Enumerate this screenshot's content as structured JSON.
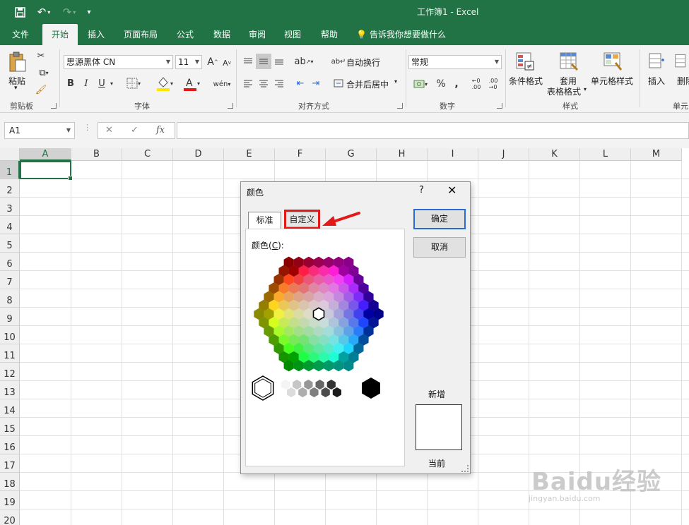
{
  "window": {
    "title": "工作簿1  -  Excel",
    "qat": [
      "save-icon",
      "undo-icon",
      "redo-icon",
      "customize-qat-icon"
    ]
  },
  "tabs": [
    {
      "label": "文件"
    },
    {
      "label": "开始",
      "active": true
    },
    {
      "label": "插入"
    },
    {
      "label": "页面布局"
    },
    {
      "label": "公式"
    },
    {
      "label": "数据"
    },
    {
      "label": "审阅"
    },
    {
      "label": "视图"
    },
    {
      "label": "帮助"
    }
  ],
  "tell_me": "告诉我你想要做什么",
  "ribbon": {
    "clipboard": {
      "paste": "粘贴",
      "label": "剪贴板"
    },
    "font": {
      "name": "思源黑体 CN",
      "size": "11",
      "label": "字体",
      "bold": "B",
      "italic": "I",
      "underline": "U",
      "font_color": "#e31919",
      "fill_color": "#ffe600"
    },
    "alignment": {
      "wrap": "自动换行",
      "merge": "合并后居中",
      "label": "对齐方式"
    },
    "number": {
      "format": "常规",
      "label": "数字",
      "percent": "%",
      "comma": ","
    },
    "styles": {
      "conditional": "条件格式",
      "table_line1": "套用",
      "table_line2": "表格格式",
      "cell_styles": "单元格样式",
      "label": "样式"
    },
    "cells": {
      "insert": "插入",
      "delete": "删除",
      "label": "单元"
    }
  },
  "formula_bar": {
    "name_box": "A1",
    "fx": "fx",
    "formula": ""
  },
  "grid": {
    "columns": [
      "A",
      "B",
      "C",
      "D",
      "E",
      "F",
      "G",
      "H",
      "I",
      "J",
      "K",
      "L",
      "M"
    ],
    "rows": [
      "1",
      "2",
      "3",
      "4",
      "5",
      "6",
      "7",
      "8",
      "9",
      "10",
      "11",
      "12",
      "13",
      "14",
      "15",
      "16",
      "17",
      "18",
      "19",
      "20"
    ],
    "selected": "A1"
  },
  "dialog": {
    "title": "颜色",
    "help": "?",
    "tabs": [
      {
        "label": "标准",
        "active": true
      },
      {
        "label": "自定义"
      }
    ],
    "colors_label_prefix": "颜色(",
    "colors_label_key": "C",
    "colors_label_suffix": "):",
    "ok": "确定",
    "cancel": "取消",
    "new_label": "新增",
    "current_label": "当前",
    "highlight_color": "#e31919"
  },
  "watermark": {
    "main": "Baidu经验",
    "sub": "jingyan.baidu.com"
  }
}
